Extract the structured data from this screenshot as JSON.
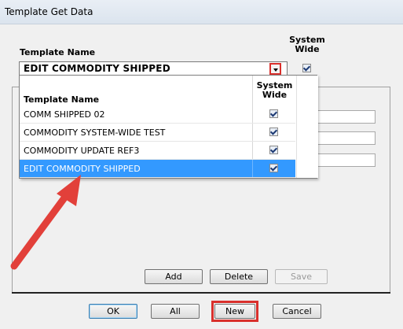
{
  "window": {
    "title": "Template Get Data"
  },
  "header": {
    "template_name_label": "Template Name",
    "system_wide_label_1": "System",
    "system_wide_label_2": "Wide"
  },
  "combo": {
    "selected_value": "EDIT COMMODITY SHIPPED",
    "system_wide_checked": true
  },
  "dropdown": {
    "col_name": "Template Name",
    "col_sys_1": "System",
    "col_sys_2": "Wide",
    "rows": [
      {
        "name": "COMM SHIPPED 02",
        "system_wide": true
      },
      {
        "name": "COMMODITY SYSTEM-WIDE TEST",
        "system_wide": true
      },
      {
        "name": "COMMODITY UPDATE REF3",
        "system_wide": true
      },
      {
        "name": "EDIT COMMODITY SHIPPED",
        "system_wide": true,
        "selected": true
      }
    ]
  },
  "group_buttons": {
    "add": "Add",
    "delete": "Delete",
    "save": "Save"
  },
  "footer_buttons": {
    "ok": "OK",
    "all": "All",
    "new": "New",
    "cancel": "Cancel"
  },
  "annotation": {
    "highlight_color": "#d9302c",
    "arrow_color": "#e2403a"
  },
  "colors": {
    "selection": "#3399ff"
  }
}
